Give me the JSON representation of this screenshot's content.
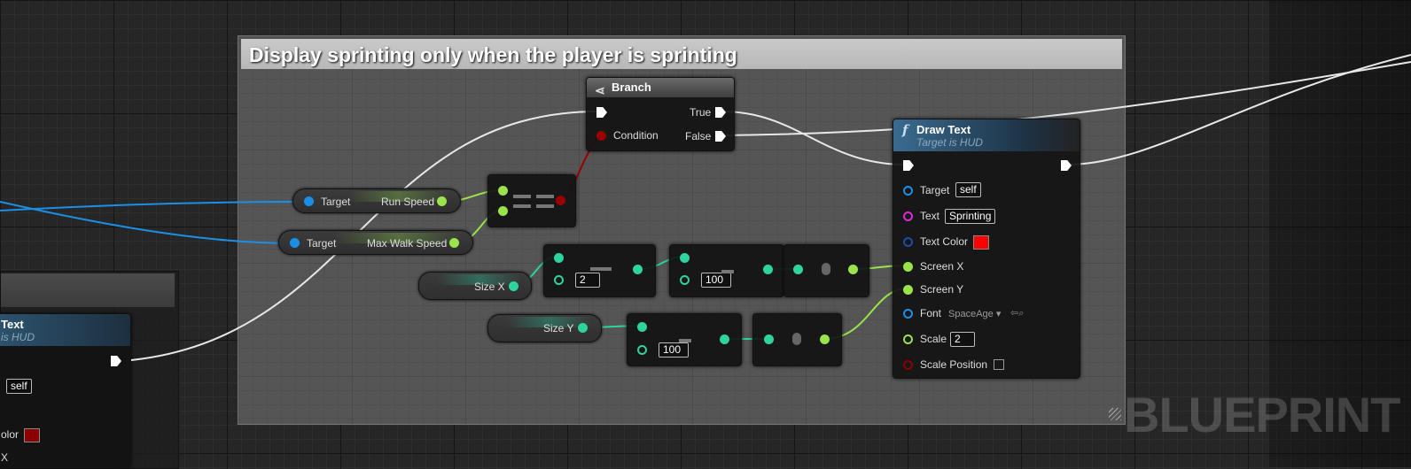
{
  "comment": {
    "title": "Display sprinting only when the player is sprinting"
  },
  "watermark": "BLUEPRINT",
  "branch": {
    "title": "Branch",
    "condition": "Condition",
    "true_label": "True",
    "false_label": "False"
  },
  "draw_text": {
    "title": "Draw Text",
    "subtitle": "Target is HUD",
    "target_label": "Target",
    "target_value": "self",
    "text_label": "Text",
    "text_value": "Sprinting",
    "text_color_label": "Text Color",
    "text_color_value": "#ff0000",
    "screen_x_label": "Screen X",
    "screen_y_label": "Screen Y",
    "font_label": "Font",
    "font_value": "SpaceAge",
    "scale_label": "Scale",
    "scale_value": "2",
    "scale_position_label": "Scale Position"
  },
  "run_speed": {
    "target": "Target",
    "value_label": "Run Speed"
  },
  "max_walk": {
    "target": "Target",
    "value_label": "Max Walk Speed"
  },
  "size_x": {
    "label": "Size X"
  },
  "size_y": {
    "label": "Size Y"
  },
  "divide_x": {
    "value": "2"
  },
  "multiply_x": {
    "value": "100"
  },
  "multiply_y": {
    "value": "100"
  },
  "left_node": {
    "title": "Text",
    "subtitle": "is HUD",
    "target_value": "self",
    "color_label": "olor",
    "trail_label": "X"
  },
  "colors": {
    "exec": "#ffffff",
    "float": "#9be34a",
    "int": "#2ed3a0",
    "object": "#1b8fe6",
    "bool": "#8a0000",
    "string": "#e02ad8"
  }
}
